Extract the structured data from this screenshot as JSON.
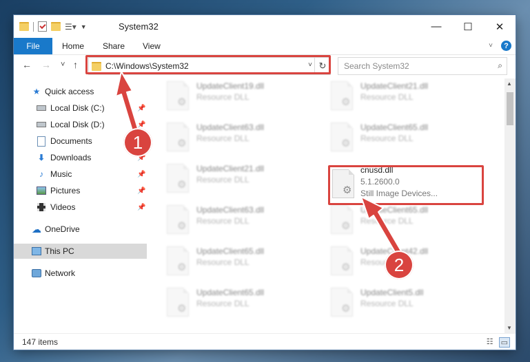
{
  "window": {
    "title": "System32",
    "controls": {
      "minimize": "—",
      "maximize": "☐",
      "close": "✕"
    }
  },
  "ribbon": {
    "tabs": [
      "File",
      "Home",
      "Share",
      "View"
    ]
  },
  "navigation": {
    "back": "←",
    "forward": "→",
    "recent": "˅",
    "up": "↑",
    "address": "C:\\Windows\\System32",
    "dropdown": "˅",
    "refresh": "↻",
    "search_placeholder": "Search System32",
    "search_icon": "⌕"
  },
  "nav_pane": {
    "items": [
      {
        "label": "Quick access",
        "icon": "star-icon",
        "pinned": false
      },
      {
        "label": "Local Disk (C:)",
        "icon": "drive-icon",
        "pinned": true
      },
      {
        "label": "Local Disk (D:)",
        "icon": "drive-icon",
        "pinned": true
      },
      {
        "label": "Documents",
        "icon": "documents-icon",
        "pinned": true
      },
      {
        "label": "Downloads",
        "icon": "download-icon",
        "pinned": true
      },
      {
        "label": "Music",
        "icon": "music-icon",
        "pinned": true
      },
      {
        "label": "Pictures",
        "icon": "pictures-icon",
        "pinned": true
      },
      {
        "label": "Videos",
        "icon": "videos-icon",
        "pinned": true
      },
      {
        "label": "OneDrive",
        "icon": "cloud-icon",
        "pinned": false
      },
      {
        "label": "This PC",
        "icon": "computer-icon",
        "pinned": false,
        "selected": true
      },
      {
        "label": "Network",
        "icon": "network-icon",
        "pinned": false
      }
    ]
  },
  "files": [
    {
      "name": "UpdateClient19.dll",
      "type": "Resource DLL"
    },
    {
      "name": "UpdateClient21.dll",
      "type": "Resource DLL"
    },
    {
      "name": "UpdateClient63.dll",
      "type": "Resource DLL"
    },
    {
      "name": "UpdateClient65.dll",
      "type": "Resource DLL"
    },
    {
      "name": "UpdateClient21.dll",
      "type": "Resource DLL"
    },
    {
      "name": "cnusd.dll",
      "version": "5.1.2600.0",
      "type": "Still Image Devices...",
      "highlighted": true
    },
    {
      "name": "UpdateClient63.dll",
      "type": "Resource DLL"
    },
    {
      "name": "UpdateClient65.dll",
      "type": "Resource DLL"
    },
    {
      "name": "UpdateClient65.dll",
      "type": "Resource DLL"
    },
    {
      "name": "UpdateClient42.dll",
      "type": "Resource DLL"
    },
    {
      "name": "UpdateClient65.dll",
      "type": "Resource DLL"
    },
    {
      "name": "UpdateClient5.dll",
      "type": "Resource DLL"
    }
  ],
  "status": {
    "item_count": "147 items"
  },
  "annotations": {
    "callout_1": "1",
    "callout_2": "2",
    "color": "#d9443f"
  }
}
